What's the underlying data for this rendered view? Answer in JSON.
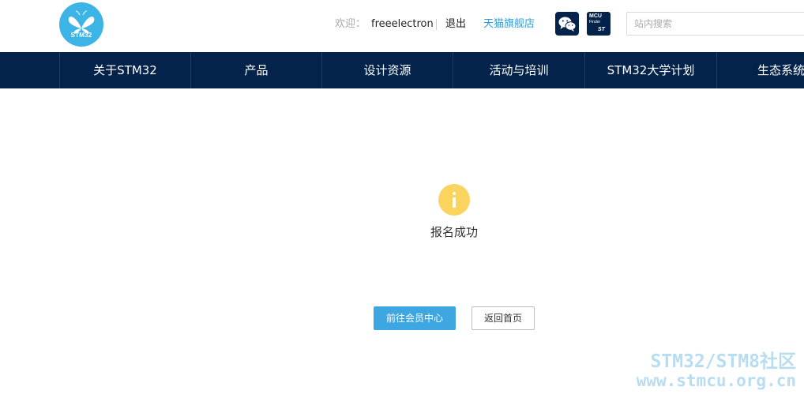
{
  "header": {
    "logo_text": "STM32",
    "welcome_label": "欢迎：",
    "username": "freeelectron",
    "logout_label": "退出",
    "store_link": "天猫旗舰店",
    "wechat_icon": "wechat-icon",
    "mcu_finder": {
      "line1": "MCU",
      "line2": "Finder",
      "brand": "ST"
    },
    "search_placeholder": "站内搜索"
  },
  "nav": {
    "items": [
      {
        "label": "关于STM32"
      },
      {
        "label": "产品"
      },
      {
        "label": "设计资源"
      },
      {
        "label": "活动与培训"
      },
      {
        "label": "STM32大学计划"
      },
      {
        "label": "生态系统"
      }
    ]
  },
  "main": {
    "status_icon": "info-icon",
    "message": "报名成功",
    "primary_button": "前往会员中心",
    "secondary_button": "返回首页"
  },
  "watermark": {
    "line1": "STM32/STM8社区",
    "line2": "www.stmcu.org.cn"
  },
  "colors": {
    "brand": "#3cb4e5",
    "nav_bg": "#03234b",
    "link": "#2c9fd8",
    "primary_button": "#3ea6e0",
    "info_icon": "#fbd35f"
  }
}
